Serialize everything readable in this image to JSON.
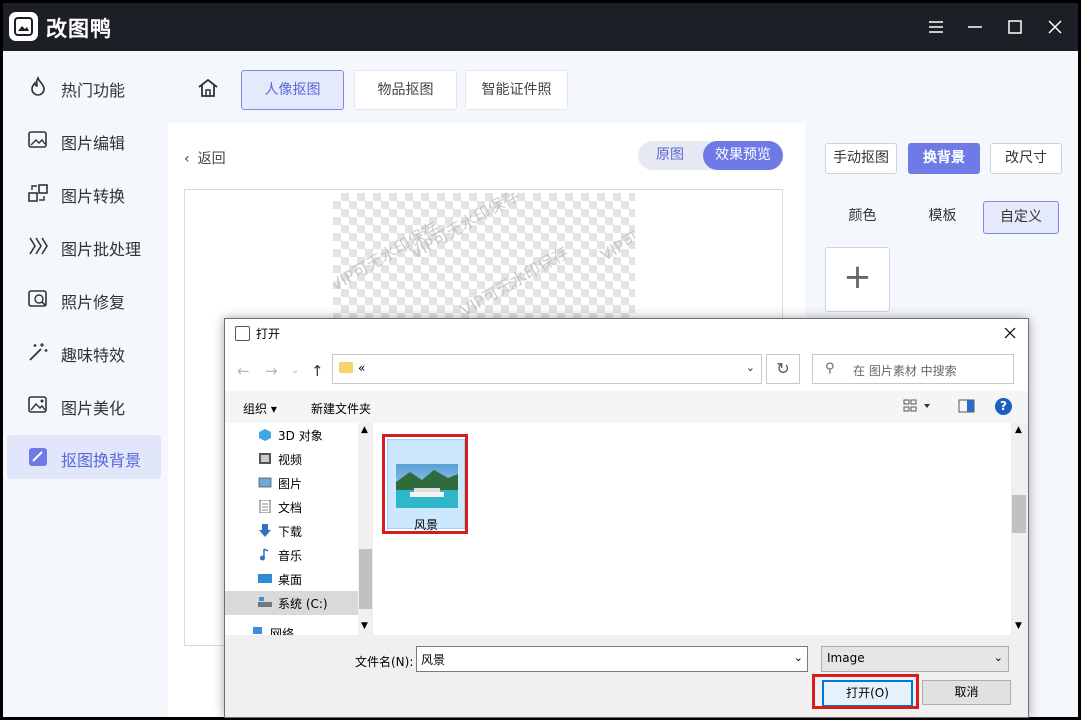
{
  "app": {
    "title": "改图鸭"
  },
  "sidebar": {
    "items": [
      {
        "label": "热门功能",
        "icon": "fire-icon"
      },
      {
        "label": "图片编辑",
        "icon": "image-edit-icon"
      },
      {
        "label": "图片转换",
        "icon": "convert-icon"
      },
      {
        "label": "图片批处理",
        "icon": "batch-icon"
      },
      {
        "label": "照片修复",
        "icon": "photo-repair-icon"
      },
      {
        "label": "趣味特效",
        "icon": "magic-wand-icon"
      },
      {
        "label": "图片美化",
        "icon": "image-beautify-icon"
      },
      {
        "label": "抠图换背景",
        "icon": "cutout-icon",
        "active": true
      }
    ]
  },
  "topnav": {
    "tabs": [
      "人像抠图",
      "物品抠图",
      "智能证件照"
    ],
    "active_tab": "人像抠图"
  },
  "editor": {
    "back_label": "返回",
    "toggle": {
      "original": "原图",
      "preview": "效果预览"
    },
    "watermark": "VIP可无水印保存"
  },
  "right_panel": {
    "mode_buttons": [
      "手动抠图",
      "换背景",
      "改尺寸"
    ],
    "active_mode": "换背景",
    "sub_tabs": [
      "颜色",
      "模板",
      "自定义"
    ],
    "active_sub_tab": "自定义",
    "add_label": "+"
  },
  "dialog": {
    "title": "打开",
    "address_path": "«",
    "search_placeholder": "在 图片素材 中搜索",
    "organize_label": "组织 ▾",
    "new_folder_label": "新建文件夹",
    "help_label": "?",
    "tree": [
      {
        "label": "3D 对象",
        "icon": "3d-objects-icon"
      },
      {
        "label": "视频",
        "icon": "video-icon"
      },
      {
        "label": "图片",
        "icon": "pictures-icon"
      },
      {
        "label": "文档",
        "icon": "documents-icon"
      },
      {
        "label": "下载",
        "icon": "download-icon"
      },
      {
        "label": "音乐",
        "icon": "music-icon"
      },
      {
        "label": "桌面",
        "icon": "desktop-icon"
      },
      {
        "label": "系统 (C:)",
        "icon": "drive-icon",
        "selected": true
      },
      {
        "label": "网络",
        "icon": "network-icon"
      }
    ],
    "files": [
      {
        "name": "风景",
        "icon": "landscape-thumbnail"
      }
    ],
    "filename_label": "文件名(N):",
    "filename_value": "风景",
    "filetype_value": "Image",
    "open_button": "打开(O)",
    "cancel_button": "取消"
  },
  "colors": {
    "accent": "#6e7be6",
    "highlight": "#d81c1c",
    "titlebar": "#1c1f25"
  }
}
